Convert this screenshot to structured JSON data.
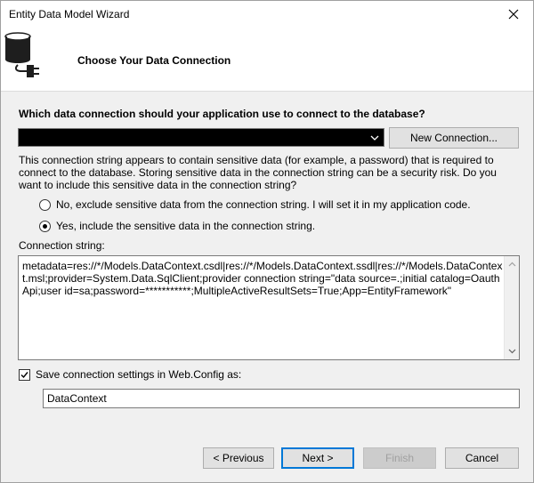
{
  "window": {
    "title": "Entity Data Model Wizard"
  },
  "header": {
    "title": "Choose Your Data Connection",
    "icon": "database-plug-icon"
  },
  "question": "Which data connection should your application use to connect to the database?",
  "connection_select": {
    "value": "",
    "icon": "chevron-down-icon"
  },
  "new_connection_label": "New Connection...",
  "info_text": "This connection string appears to contain sensitive data (for example, a password) that is required to connect to the database. Storing sensitive data in the connection string can be a security risk. Do you want to include this sensitive data in the connection string?",
  "radios": [
    {
      "label": "No, exclude sensitive data from the connection string. I will set it in my application code.",
      "checked": false
    },
    {
      "label": "Yes, include the sensitive data in the connection string.",
      "checked": true
    }
  ],
  "connection_string": {
    "label": "Connection string:",
    "value": "metadata=res://*/Models.DataContext.csdl|res://*/Models.DataContext.ssdl|res://*/Models.DataContext.msl;provider=System.Data.SqlClient;provider connection string=\"data source=.;initial catalog=OauthApi;user id=sa;password=***********;MultipleActiveResultSets=True;App=EntityFramework\""
  },
  "save_settings": {
    "label": "Save connection settings in Web.Config as:",
    "checked": true,
    "value": "DataContext"
  },
  "buttons": {
    "previous": "< Previous",
    "next": "Next >",
    "finish": "Finish",
    "cancel": "Cancel"
  },
  "colors": {
    "accent": "#0078d7",
    "header_bg": "#ffffff",
    "dialog_bg": "#f0f0f0"
  }
}
